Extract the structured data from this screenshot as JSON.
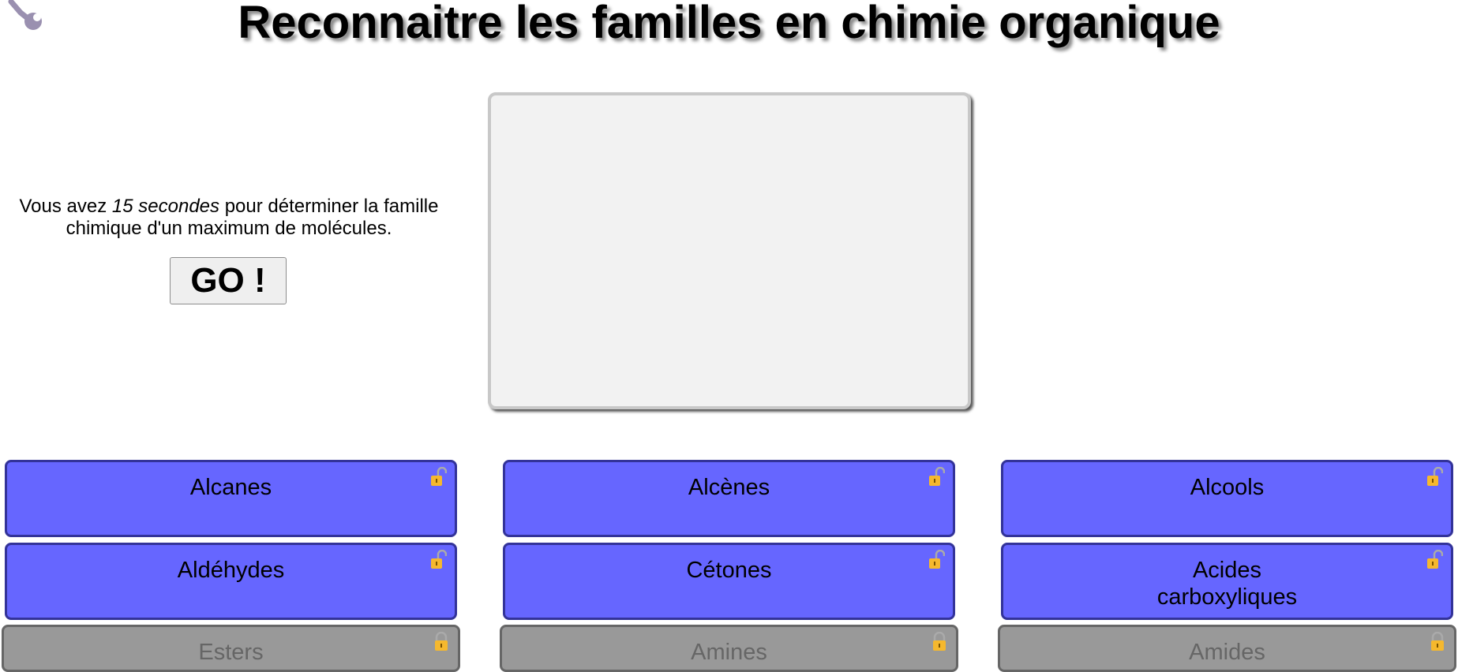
{
  "header": {
    "title": "Reconnaitre les familles en chimie organique",
    "settings_icon": "wrench-icon"
  },
  "intro": {
    "before": "Vous avez ",
    "emphasis": "15 secondes",
    "after": " pour déterminer la famille chimique d'un maximum de molécules."
  },
  "go_label": "GO !",
  "families": [
    {
      "label": "Alcanes",
      "state": "unlocked"
    },
    {
      "label": "Alcènes",
      "state": "unlocked"
    },
    {
      "label": "Alcools",
      "state": "unlocked"
    },
    {
      "label": "Aldéhydes",
      "state": "unlocked"
    },
    {
      "label": "Cétones",
      "state": "unlocked"
    },
    {
      "label": "Acides carboxyliques",
      "state": "unlocked"
    },
    {
      "label": "Esters",
      "state": "locked"
    },
    {
      "label": "Amines",
      "state": "locked"
    },
    {
      "label": "Amides",
      "state": "locked"
    }
  ],
  "colors": {
    "active_button": "#6666ff",
    "active_border": "#333399",
    "locked_button": "#999999",
    "padlock": "#f5b82e"
  }
}
